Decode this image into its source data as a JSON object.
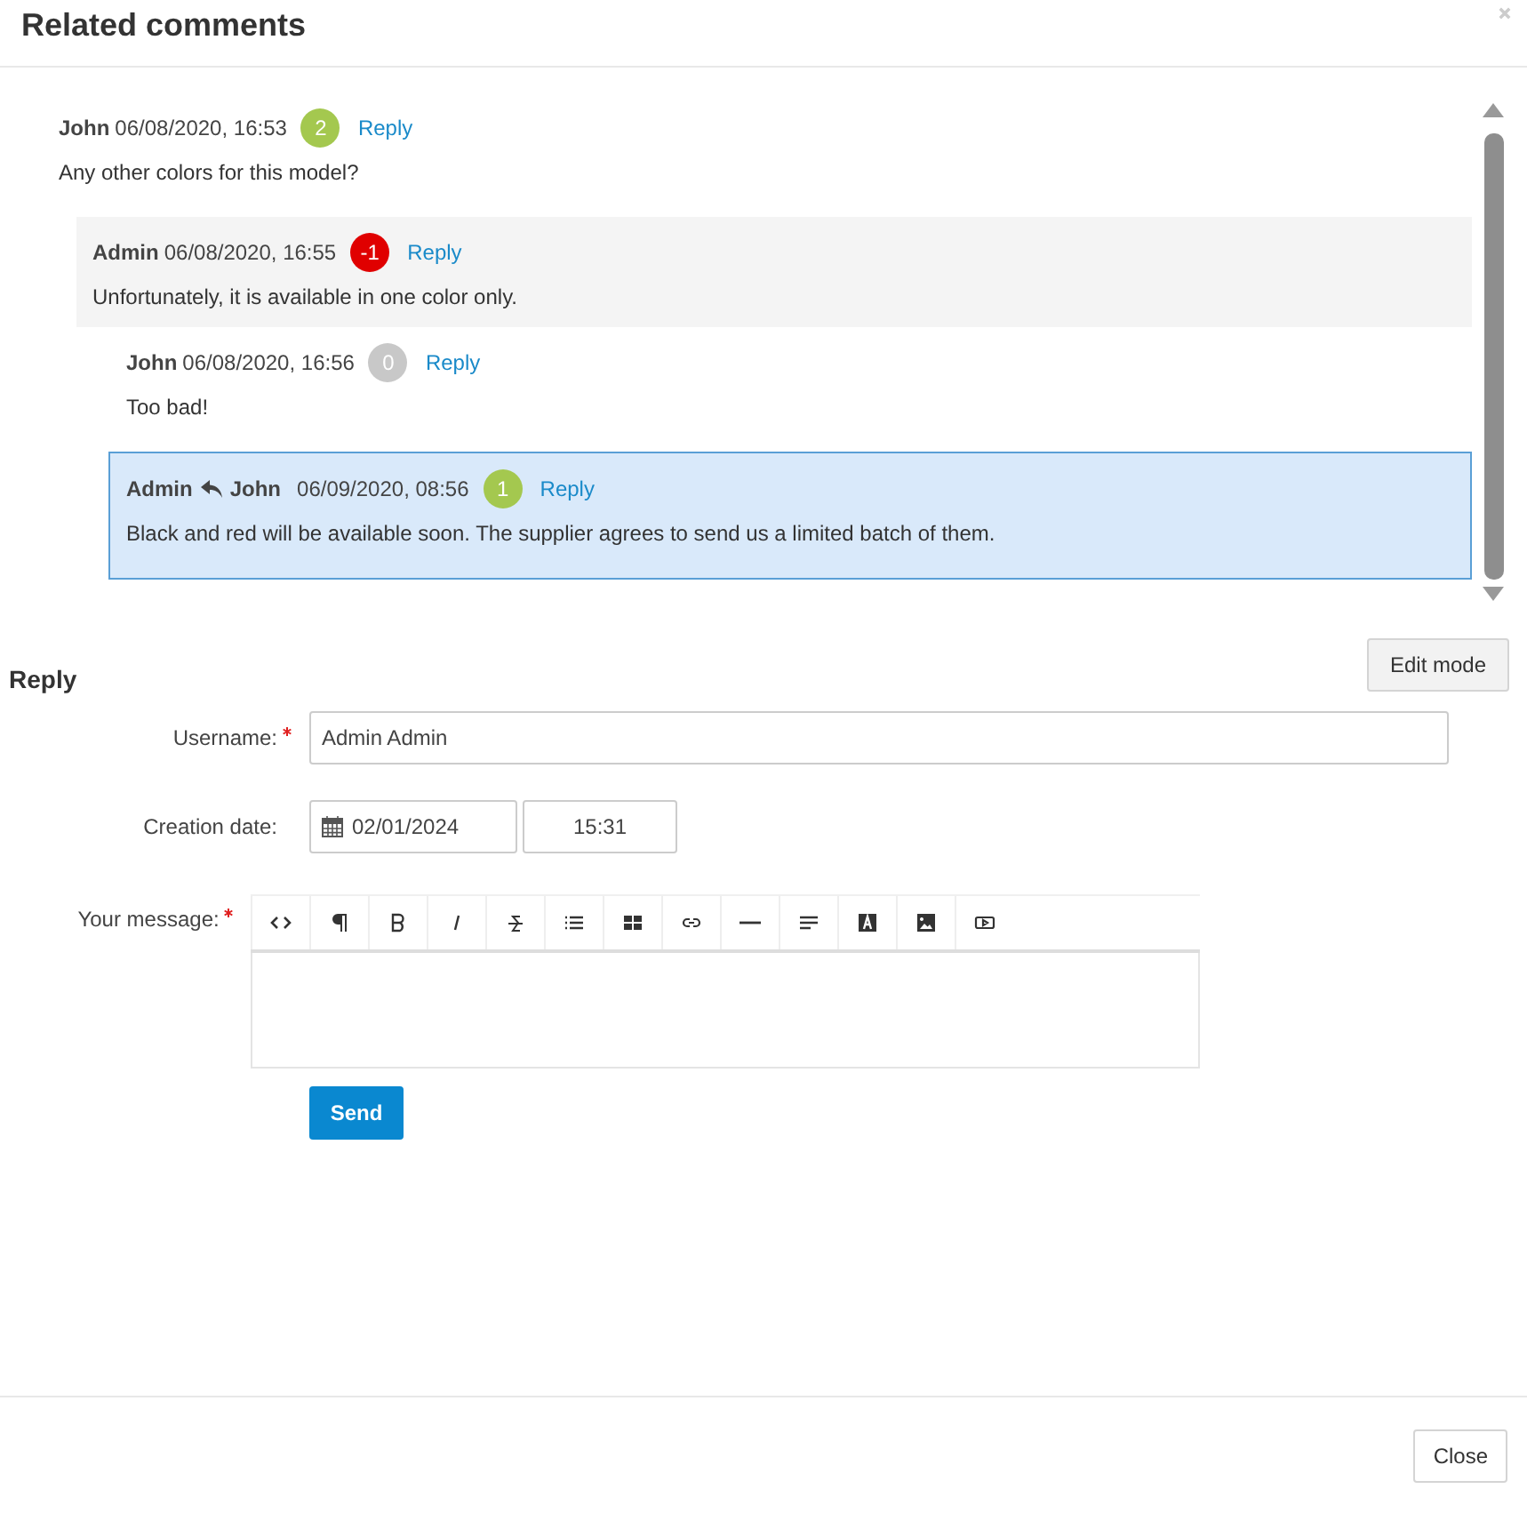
{
  "dialog": {
    "title": "Related comments",
    "close_label": "Close"
  },
  "comments": [
    {
      "author": "John",
      "date": "06/08/2020, 16:53",
      "score": "2",
      "color": "#a4c84f",
      "reply_label": "Reply",
      "text": "Any other colors for this model?",
      "shaded": false,
      "selected": false,
      "children": [
        {
          "author": "Admin",
          "date": "06/08/2020, 16:55",
          "score": "-1",
          "color": "#e00000",
          "reply_label": "Reply",
          "text": "Unfortunately, it is available in one color only.",
          "shaded": true,
          "selected": false,
          "children": [
            {
              "author": "John",
              "date": "06/08/2020, 16:56",
              "score": "0",
              "color": "#c8c8c8",
              "reply_label": "Reply",
              "text": "Too bad!",
              "shaded": false,
              "selected": false
            },
            {
              "author": "Admin",
              "reply_to": "John",
              "date": "06/09/2020, 08:56",
              "score": "1",
              "color": "#a4c84f",
              "reply_label": "Reply",
              "text": "Black and red will be available soon. The supplier agrees to send us a limited batch of them.",
              "shaded": false,
              "selected": true
            }
          ]
        }
      ]
    }
  ],
  "reply_form": {
    "title": "Reply",
    "edit_mode_label": "Edit mode",
    "fields": [
      {
        "kind": "text",
        "label": "Username:",
        "required": true,
        "value": "Admin Admin"
      },
      {
        "kind": "datetime",
        "label": "Creation date:",
        "required": false,
        "date": "02/01/2024",
        "time": "15:31"
      },
      {
        "kind": "editor",
        "label": "Your message:",
        "required": true
      }
    ],
    "send_label": "Send"
  }
}
